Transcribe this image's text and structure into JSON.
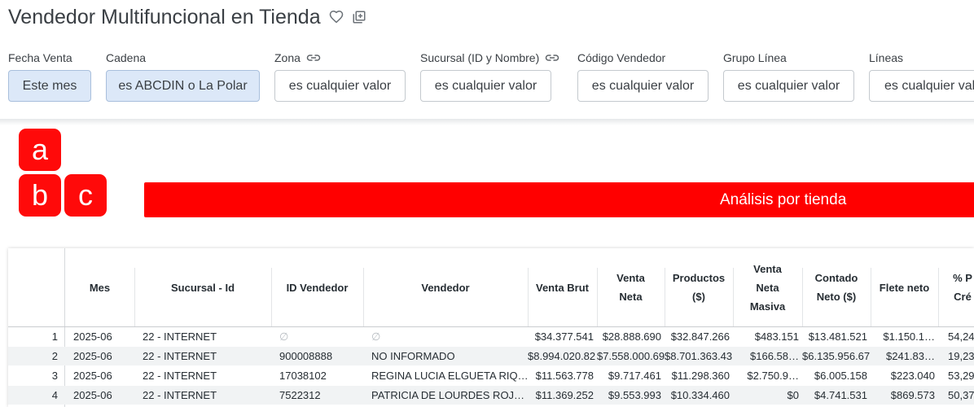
{
  "header": {
    "title": "Vendedor Multifuncional en Tienda",
    "favorite_icon": "heart-outline-icon",
    "copy_icon": "library-add-icon"
  },
  "filters": [
    {
      "label": "Fecha Venta",
      "value": "Este mes",
      "active": true,
      "linked": false
    },
    {
      "label": "Cadena",
      "value": "es ABCDIN o La Polar",
      "active": true,
      "linked": false
    },
    {
      "label": "Zona",
      "value": "es cualquier valor",
      "active": false,
      "linked": true
    },
    {
      "label": "Sucursal (ID y Nombre)",
      "value": "es cualquier valor",
      "active": false,
      "linked": true
    },
    {
      "label": "Código Vendedor",
      "value": "es cualquier valor",
      "active": false,
      "linked": false
    },
    {
      "label": "Grupo Línea",
      "value": "es cualquier valor",
      "active": false,
      "linked": false
    },
    {
      "label": "Líneas",
      "value": "es cualquier valor",
      "active": false,
      "linked": false
    }
  ],
  "logo": {
    "letters": [
      "a",
      "b",
      "c"
    ],
    "color": "#ff0a0a"
  },
  "banner": {
    "text": "Análisis por tienda",
    "color": "#ff0000"
  },
  "table": {
    "columns": [
      {
        "key": "idx",
        "label": ""
      },
      {
        "key": "mes",
        "label": "Mes"
      },
      {
        "key": "sucursal",
        "label": "Sucursal - Id"
      },
      {
        "key": "id_vendedor",
        "label": "ID Vendedor"
      },
      {
        "key": "vendedor",
        "label": "Vendedor"
      },
      {
        "key": "venta_brut",
        "label": "Venta Brut"
      },
      {
        "key": "venta_neta",
        "label": "Venta\nNeta"
      },
      {
        "key": "productos",
        "label": "Productos\n($)"
      },
      {
        "key": "venta_neta_masiva",
        "label": "Venta\nNeta\nMasiva"
      },
      {
        "key": "contado",
        "label": "Contado\nNeto ($)"
      },
      {
        "key": "flete",
        "label": "Flete neto"
      },
      {
        "key": "pct",
        "label": "% P\nCré"
      }
    ],
    "rows": [
      [
        "1",
        "2025-06",
        "22 - INTERNET",
        "∅",
        "∅",
        "$34.377.541",
        "$28.888.690",
        "$32.847.266",
        "$483.151",
        "$13.481.521",
        "$1.150.1…",
        "54,24"
      ],
      [
        "2",
        "2025-06",
        "22 - INTERNET",
        "900008888",
        "NO INFORMADO",
        "$8.994.020.82",
        "$7.558.000.69",
        "$8.701.363.43",
        "$166.58…",
        "$6.135.956.67",
        "$241.83…",
        "19,23"
      ],
      [
        "3",
        "2025-06",
        "22 - INTERNET",
        "17038102",
        "REGINA LUCIA ELGUETA RIQ…",
        "$11.563.778",
        "$9.717.461",
        "$11.298.360",
        "$2.750.9…",
        "$6.005.158",
        "$223.040",
        "53,29"
      ],
      [
        "4",
        "2025-06",
        "22 - INTERNET",
        "7522312",
        "PATRICIA DE LOURDES ROJ…",
        "$11.369.252",
        "$9.553.993",
        "$10.334.460",
        "$0",
        "$4.741.531",
        "$869.573",
        "50,37"
      ]
    ]
  }
}
